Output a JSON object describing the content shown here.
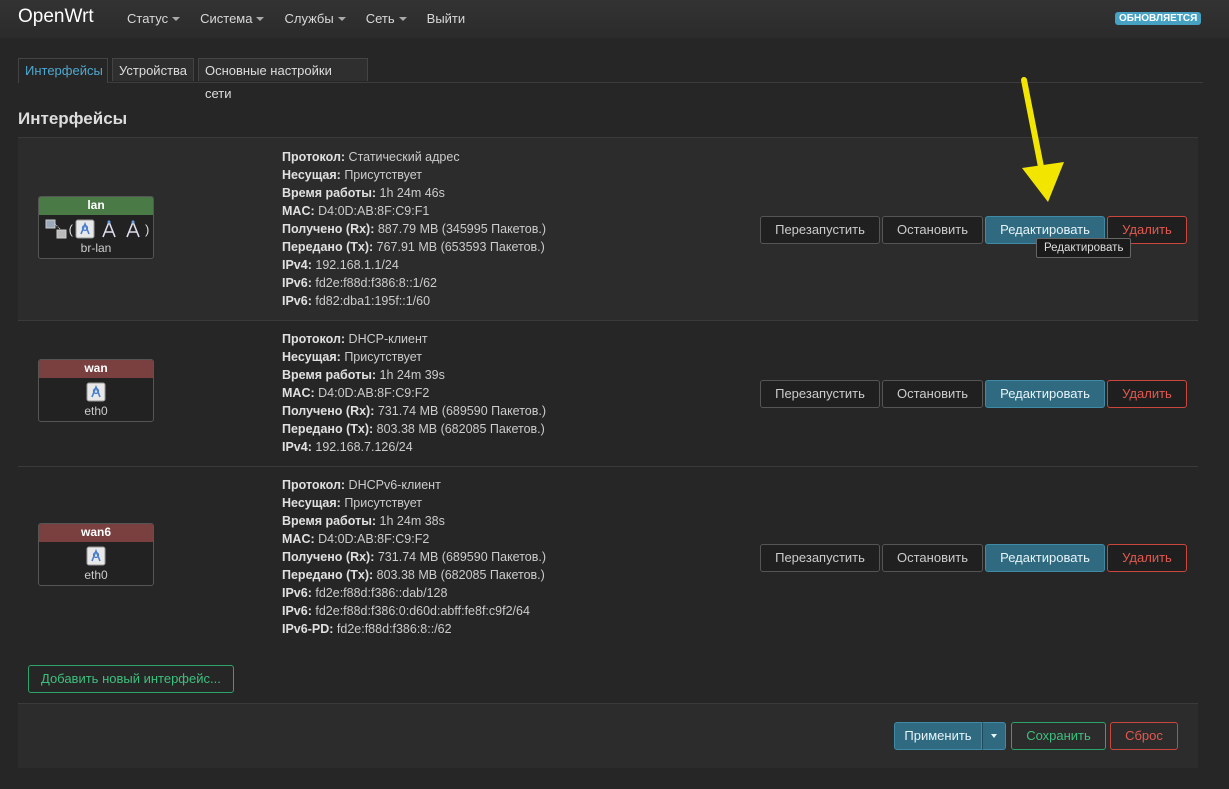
{
  "header": {
    "brand": "OpenWrt",
    "menu": [
      {
        "label": "Статус",
        "has_dropdown": true
      },
      {
        "label": "Система",
        "has_dropdown": true
      },
      {
        "label": "Службы",
        "has_dropdown": true
      },
      {
        "label": "Сеть",
        "has_dropdown": true
      },
      {
        "label": "Выйти",
        "has_dropdown": false
      }
    ],
    "status_badge": "ОБНОВЛЯЕТСЯ",
    "status_badge_color": "#46a1c2"
  },
  "tabs": [
    {
      "label": "Интерфейсы",
      "active": true
    },
    {
      "label": "Устройства",
      "active": false
    },
    {
      "label": "Основные настройки сети",
      "active": false
    }
  ],
  "page_title": "Интерфейсы",
  "interfaces": [
    {
      "name": "lan",
      "color": "#4a7a45",
      "device": "br-lan",
      "icons": [
        "bridge-icon",
        "ethernet-icon",
        "wifi-icon",
        "wifi-icon"
      ],
      "info": [
        {
          "label": "Протокол:",
          "value": "Статический адрес"
        },
        {
          "label": "Несущая:",
          "value": "Присутствует"
        },
        {
          "label": "Время работы:",
          "value": "1h 24m 46s"
        },
        {
          "label": "MAC:",
          "value": "D4:0D:AB:8F:C9:F1"
        },
        {
          "label": "Получено (Rx):",
          "value": "887.79 MB (345995 Пакетов.)"
        },
        {
          "label": "Передано (Tx):",
          "value": "767.91 MB (653593 Пакетов.)"
        },
        {
          "label": "IPv4:",
          "value": "192.168.1.1/24"
        },
        {
          "label": "IPv6:",
          "value": "fd2e:f88d:f386:8::1/62"
        },
        {
          "label": "IPv6:",
          "value": "fd82:dba1:195f::1/60"
        }
      ]
    },
    {
      "name": "wan",
      "color": "#7a3f3f",
      "device": "eth0",
      "icons": [
        "ethernet-icon"
      ],
      "info": [
        {
          "label": "Протокол:",
          "value": "DHCP-клиент"
        },
        {
          "label": "Несущая:",
          "value": "Присутствует"
        },
        {
          "label": "Время работы:",
          "value": "1h 24m 39s"
        },
        {
          "label": "MAC:",
          "value": "D4:0D:AB:8F:C9:F2"
        },
        {
          "label": "Получено (Rx):",
          "value": "731.74 MB (689590 Пакетов.)"
        },
        {
          "label": "Передано (Tx):",
          "value": "803.38 MB (682085 Пакетов.)"
        },
        {
          "label": "IPv4:",
          "value": "192.168.7.126/24"
        }
      ]
    },
    {
      "name": "wan6",
      "color": "#7a3f3f",
      "device": "eth0",
      "icons": [
        "ethernet-icon"
      ],
      "info": [
        {
          "label": "Протокол:",
          "value": "DHCPv6-клиент"
        },
        {
          "label": "Несущая:",
          "value": "Присутствует"
        },
        {
          "label": "Время работы:",
          "value": "1h 24m 38s"
        },
        {
          "label": "MAC:",
          "value": "D4:0D:AB:8F:C9:F2"
        },
        {
          "label": "Получено (Rx):",
          "value": "731.74 MB (689590 Пакетов.)"
        },
        {
          "label": "Передано (Tx):",
          "value": "803.38 MB (682085 Пакетов.)"
        },
        {
          "label": "IPv6:",
          "value": "fd2e:f88d:f386::dab/128"
        },
        {
          "label": "IPv6:",
          "value": "fd2e:f88d:f386:0:d60d:abff:fe8f:c9f2/64"
        },
        {
          "label": "IPv6-PD:",
          "value": "fd2e:f88d:f386:8::/62"
        }
      ]
    }
  ],
  "row_buttons": {
    "restart": "Перезапустить",
    "stop": "Остановить",
    "edit": "Редактировать",
    "delete": "Удалить"
  },
  "tooltip": "Редактировать",
  "add_interface": "Добавить новый интерфейс...",
  "footer": {
    "apply": "Применить",
    "save": "Сохранить",
    "reset": "Сброс"
  },
  "annotation_arrow_color": "#f2e600"
}
